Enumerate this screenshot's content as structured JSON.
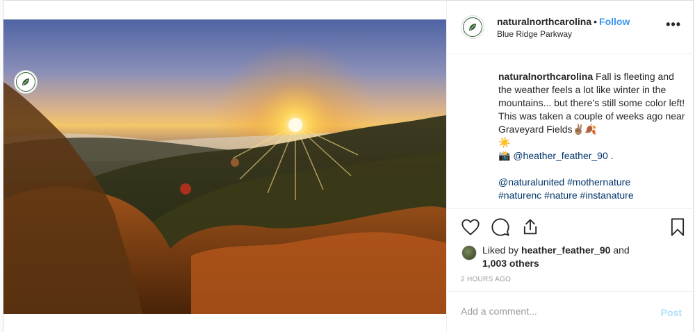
{
  "post": {
    "author": "naturalnorthcarolina",
    "follow_label": "Follow",
    "separator": "•",
    "location": "Blue Ridge Parkway",
    "more_label": "•••"
  },
  "caption": {
    "username": "naturalnorthcarolina",
    "text_part1": " Fall is fleeting and the weather feels a lot like winter in the mountains... but there’s still some color left! This was taken a couple of weeks ago near Graveyard Fields",
    "emojis1": "✌🏽🍂",
    "emoji2": "☀️",
    "emoji3": "📸",
    "mention": "@heather_feather_90",
    "mention_suffix": " .",
    "hashtags_line1": [
      "@naturalunited",
      "#mothernature"
    ],
    "hashtags_line2": [
      "#naturenc",
      "#nature",
      "#instanature"
    ]
  },
  "likes": {
    "prefix": "Liked by ",
    "user": "heather_feather_90",
    "and": " and",
    "others": "1,003 others"
  },
  "timestamp": "2 HOURS AGO",
  "comment": {
    "placeholder": "Add a comment...",
    "post_label": "Post"
  },
  "colors": {
    "follow": "#3897f0",
    "link": "#003569",
    "post_disabled": "#b2dffc",
    "muted": "#999999"
  },
  "icons": [
    "heart-icon",
    "comment-icon",
    "share-icon",
    "bookmark-icon",
    "more-icon",
    "leaf-logo-icon"
  ]
}
